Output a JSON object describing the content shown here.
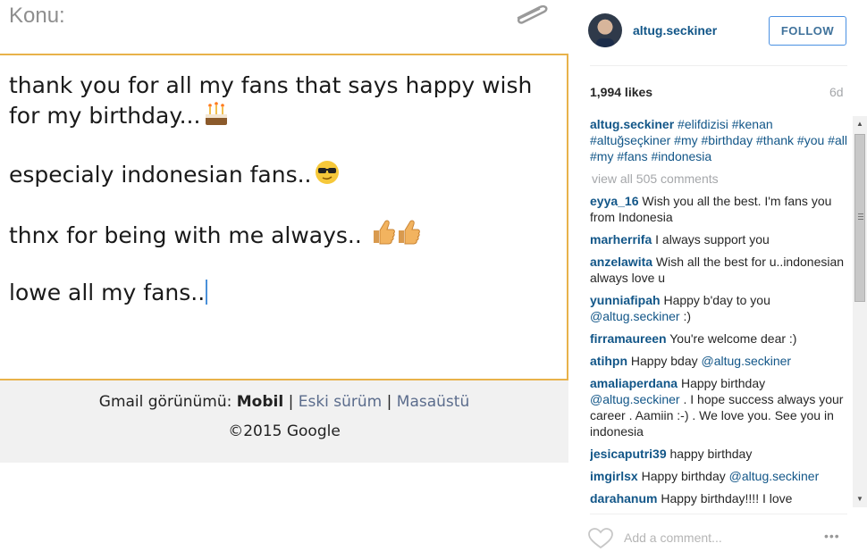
{
  "compose": {
    "subject_label": "Konu:",
    "body_lines": [
      {
        "text": "thank you for all my fans that says happy wish for my  birthday...",
        "emoji": "cake-emoji"
      },
      {
        "text": "especialy indonesian fans..",
        "emoji": "sunglasses-emoji"
      },
      {
        "text": "thnx for being with me always.. ",
        "emoji": "thumbs-up-emoji"
      },
      {
        "text": "lowe all my fans..",
        "emoji": ""
      }
    ],
    "accent_color": "#e8b24a"
  },
  "footer": {
    "view_prefix": "Gmail görünümü:",
    "mobile": "Mobil",
    "separator": "|",
    "old_version": "Eski sürüm",
    "desktop": "Masaüstü",
    "copyright": "©2015 Google"
  },
  "instagram": {
    "username": "altug.seckiner",
    "follow_label": "FOLLOW",
    "likes": "1,994 likes",
    "time": "6d",
    "caption": {
      "user": "altug.seckiner",
      "text": "#elifdizisi #kenan #altuğseçkiner #my #birthday #thank #you #all #my #fans #indonesia"
    },
    "view_all": "view all 505 comments",
    "comments": [
      {
        "user": "eyya_16",
        "text": "Wish you all the best. I'm fans you from Indonesia",
        "tag": ""
      },
      {
        "user": "marherrifa",
        "text": "I always support you",
        "tag": ""
      },
      {
        "user": "anzelawita",
        "text": "Wish all the best for u..indonesian always love u",
        "tag": ""
      },
      {
        "user": "yunniafipah",
        "text": "Happy b'day to you",
        "tag": "@altug.seckiner",
        "after": " :)"
      },
      {
        "user": "firramaureen",
        "text": "You're welcome dear :)",
        "tag": ""
      },
      {
        "user": "atihpn",
        "text": "Happy bday",
        "tag": "@altug.seckiner"
      },
      {
        "user": "amaliaperdana",
        "text": "Happy birthday",
        "tag": "@altug.seckiner",
        "after": " . I hope success always your career . Aamiin :-) . We love you. See you in indonesia"
      },
      {
        "user": "jesicaputri39",
        "text": "happy birthday",
        "tag": ""
      },
      {
        "user": "imgirlsx",
        "text": "Happy birthday",
        "tag": "@altug.seckiner"
      },
      {
        "user": "darahanum",
        "text": "Happy birthday!!!! I love",
        "tag": ""
      }
    ],
    "add_comment_placeholder": "Add a comment...",
    "more_label": "•••",
    "link_color": "#125688"
  }
}
